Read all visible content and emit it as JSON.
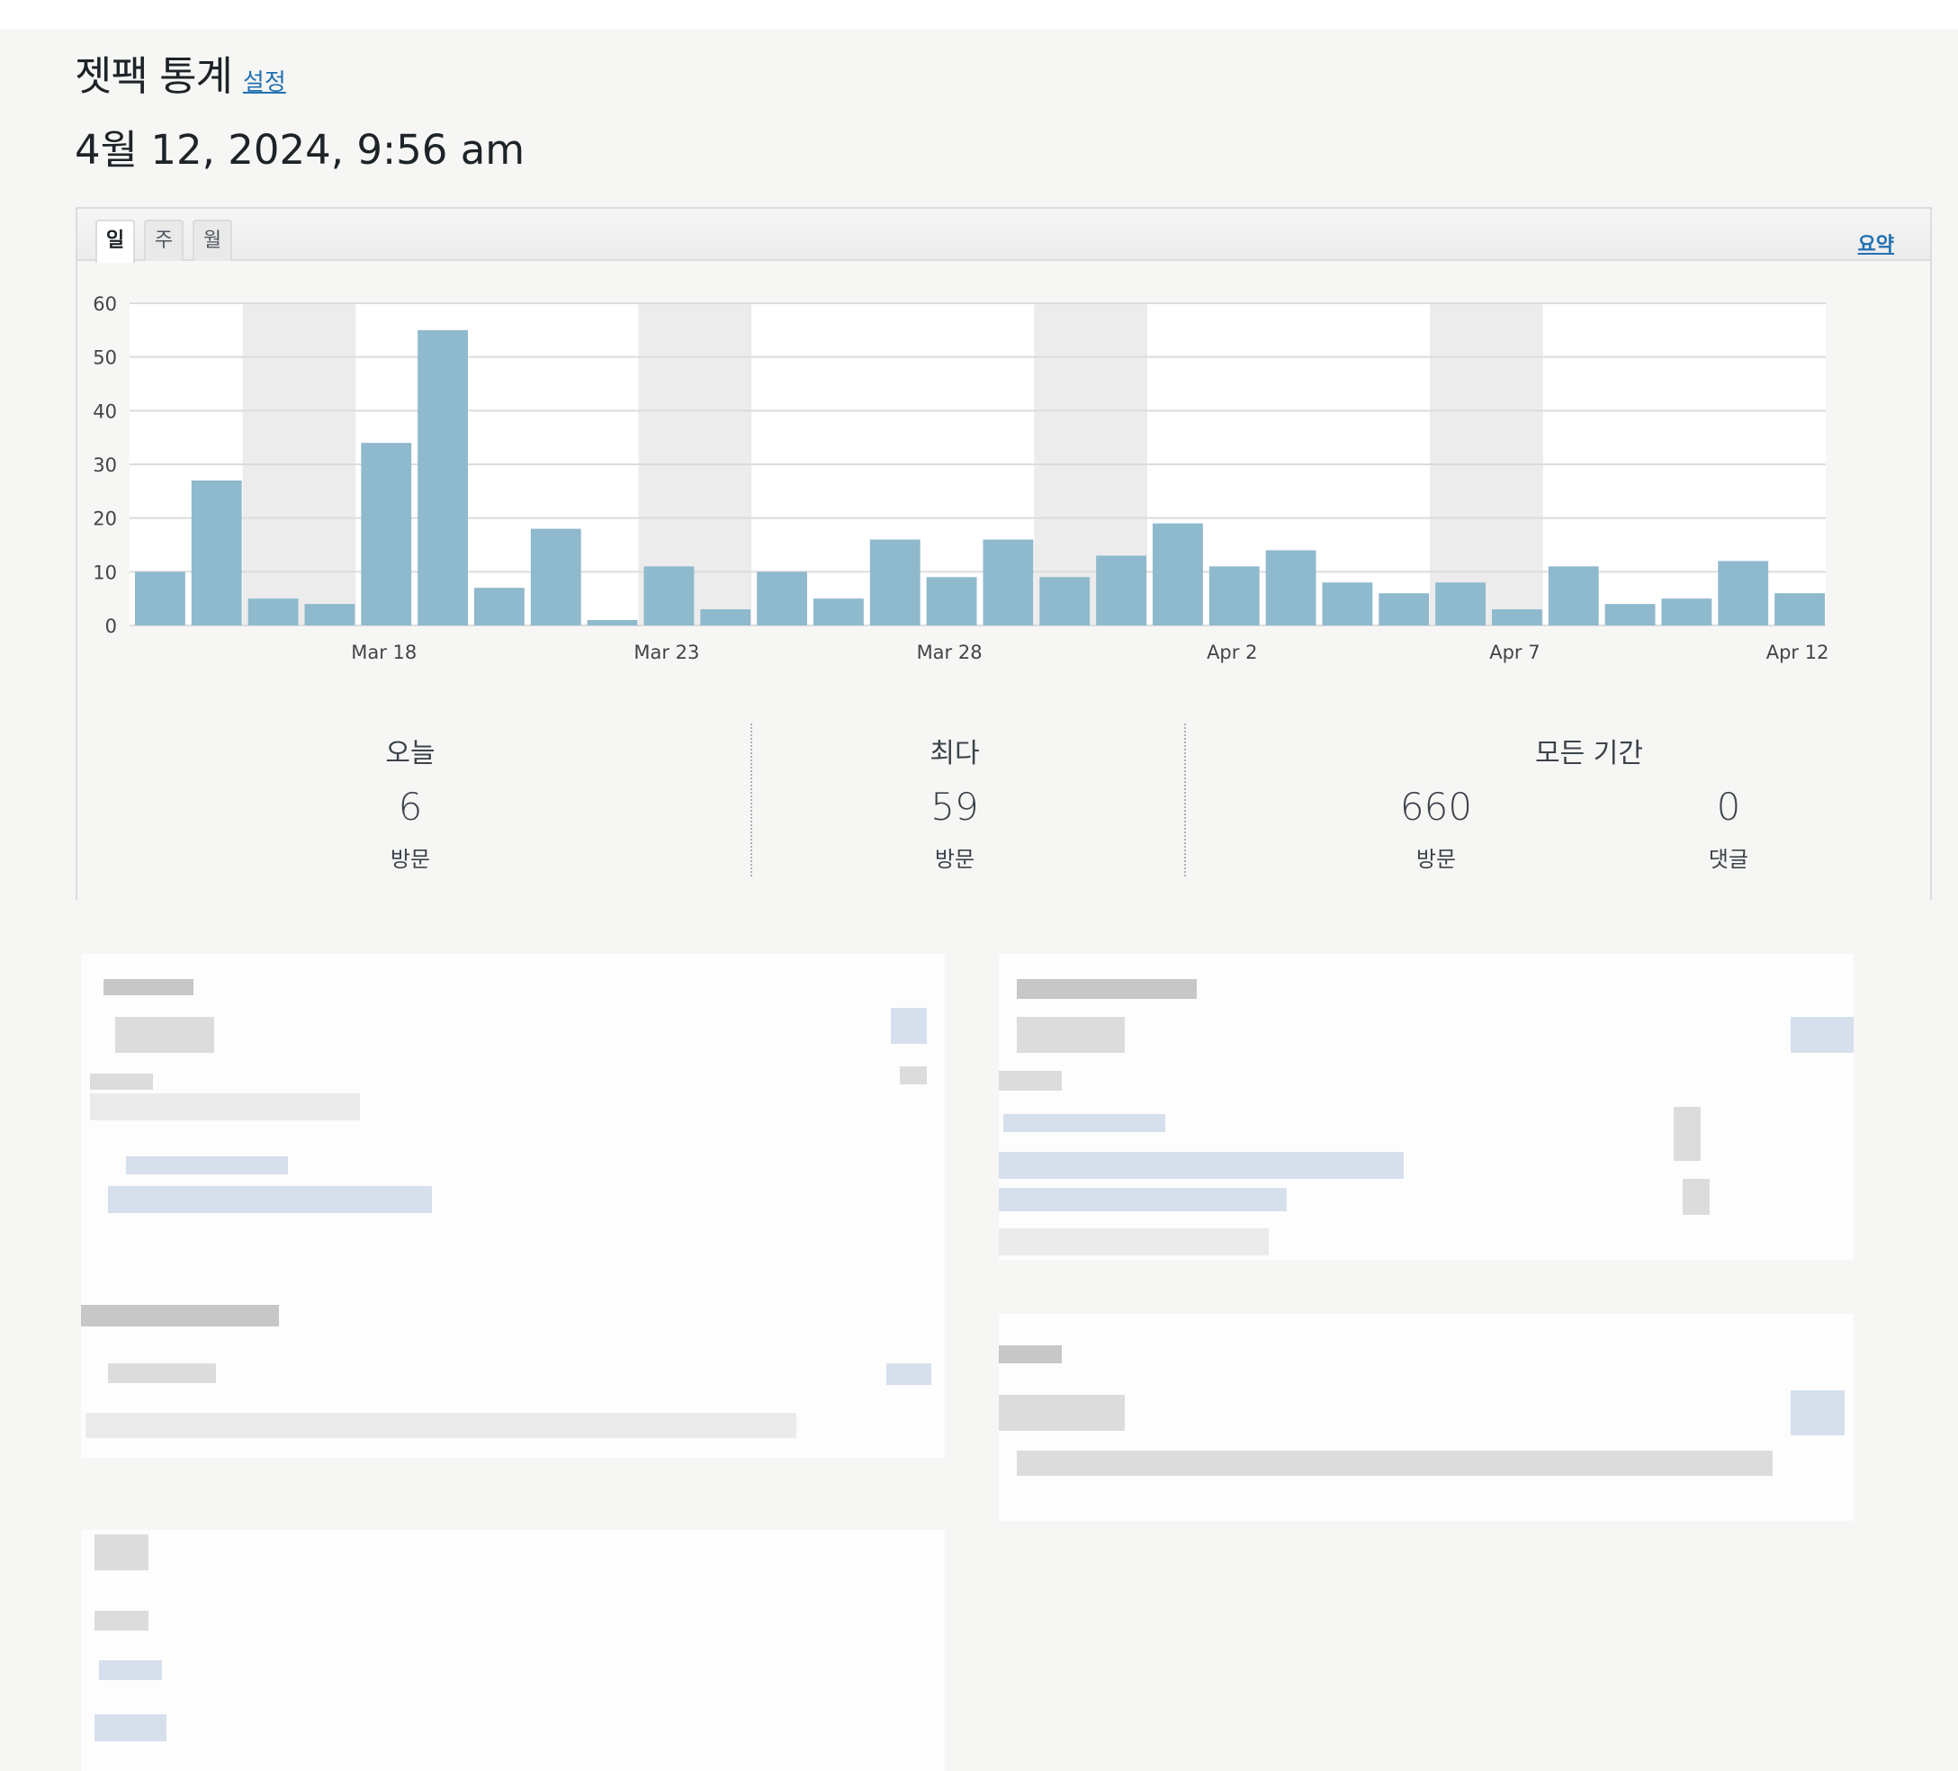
{
  "header": {
    "title": "젯팩 통계",
    "settings_label": "설정",
    "datetime": "4월 12, 2024, 9:56 am"
  },
  "tabs": [
    {
      "label": "일",
      "active": true
    },
    {
      "label": "주",
      "active": false
    },
    {
      "label": "월",
      "active": false
    }
  ],
  "summary_label": "요약",
  "colors": {
    "bar": "#8fb9cd",
    "weekend_band": "#ececec",
    "grid": "#dcdcdc",
    "link": "#2271b1"
  },
  "chart_data": {
    "type": "bar",
    "values": [
      10,
      27,
      5,
      4,
      34,
      55,
      7,
      18,
      1,
      11,
      3,
      10,
      5,
      16,
      9,
      16,
      9,
      13,
      19,
      11,
      14,
      8,
      6,
      8,
      3,
      11,
      4,
      5,
      12,
      6
    ],
    "x_tick_labels": [
      "Mar 18",
      "Mar 23",
      "Mar 28",
      "Apr 2",
      "Apr 7",
      "Apr 12"
    ],
    "x_tick_indices": [
      4.5,
      9.5,
      14.5,
      19.5,
      24.5,
      29.5
    ],
    "y_ticks": [
      0,
      10,
      20,
      30,
      40,
      50,
      60
    ],
    "ylim": [
      0,
      60
    ],
    "weekend_band_indices": [
      [
        2,
        3
      ],
      [
        9,
        10
      ],
      [
        16,
        17
      ],
      [
        23,
        24
      ]
    ],
    "grid": true
  },
  "stats": {
    "today": {
      "label": "오늘",
      "value": "6",
      "unit": "방문"
    },
    "best": {
      "label": "최다",
      "value": "59",
      "unit": "방문"
    },
    "all_time": {
      "label": "모든 기간",
      "visits_value": "660",
      "visits_unit": "방문",
      "comments_value": "0",
      "comments_unit": "댓글"
    }
  }
}
